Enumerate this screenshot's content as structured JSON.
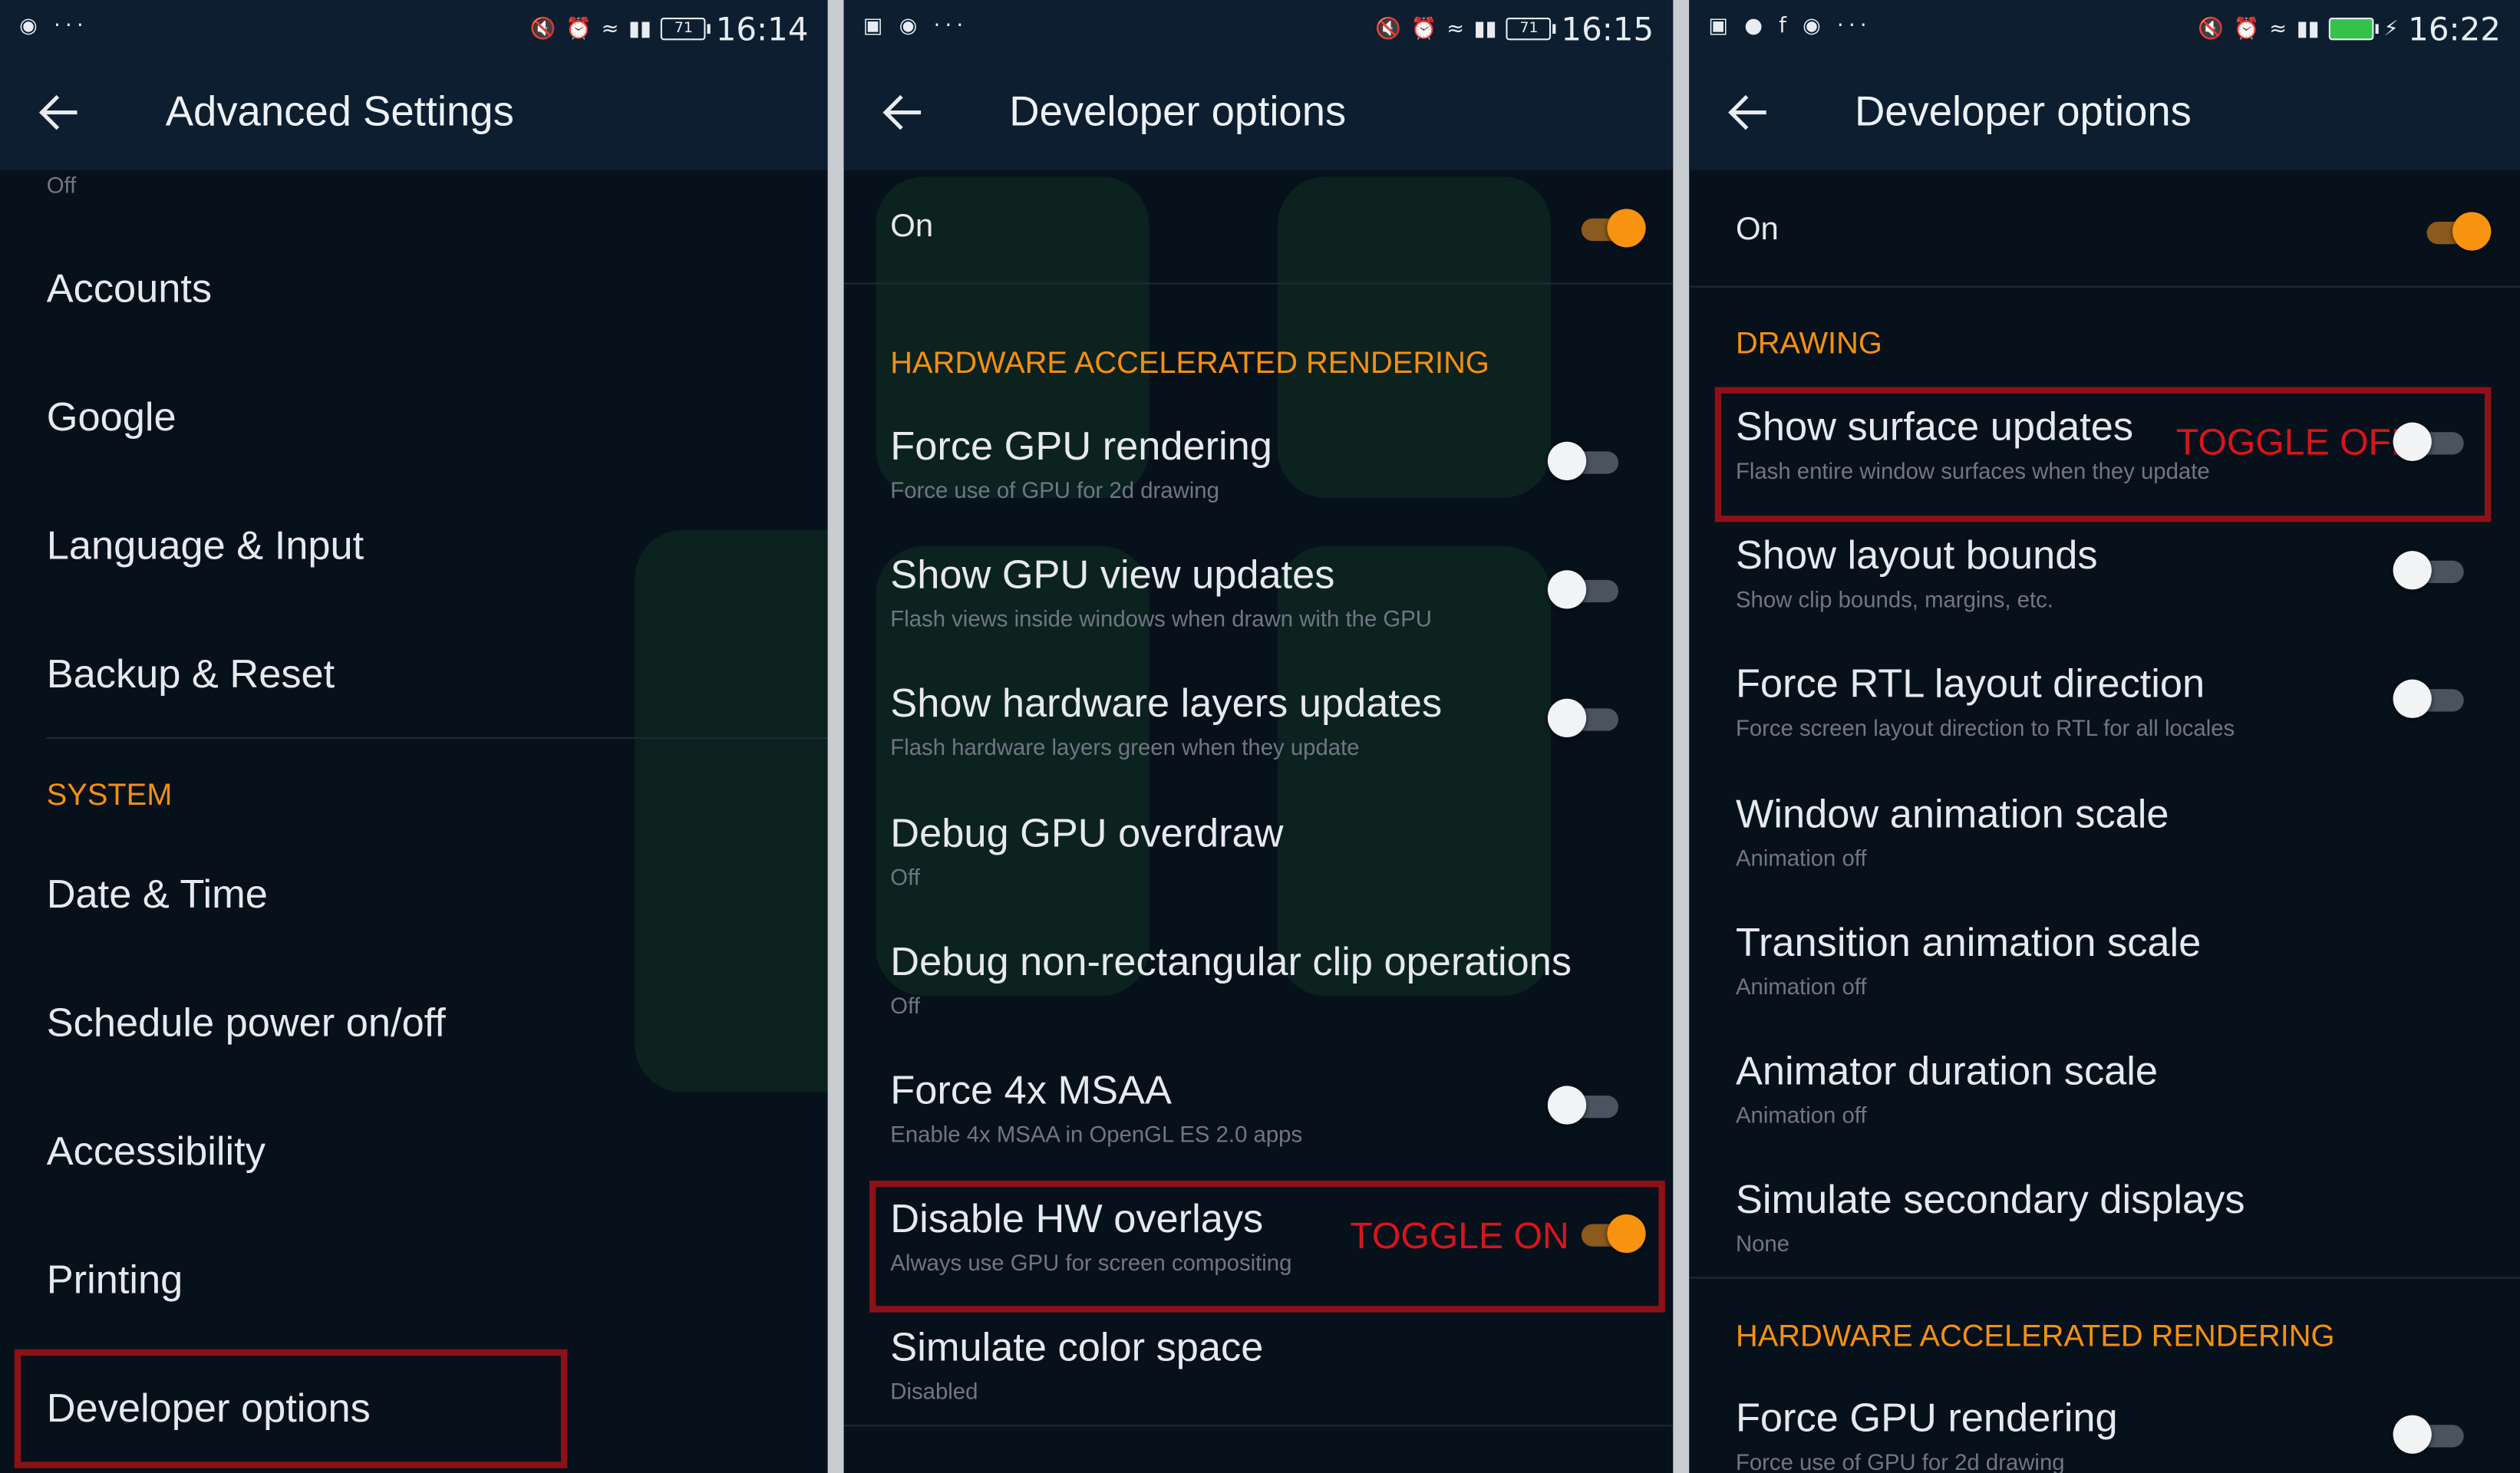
{
  "colors": {
    "accent": "#f7930f",
    "annotation": "#d8151b",
    "panel_bg": "#07111c",
    "bar_bg": "#0c1e30"
  },
  "panel1": {
    "status": {
      "left": "◉ ···",
      "battery": "71",
      "time": "16:14"
    },
    "title": "Advanced Settings",
    "partial_sub": "Off",
    "items": [
      {
        "label": "Accounts"
      },
      {
        "label": "Google"
      },
      {
        "label": "Language & Input"
      },
      {
        "label": "Backup & Reset"
      }
    ],
    "section": "SYSTEM",
    "system_items": [
      {
        "label": "Date & Time"
      },
      {
        "label": "Schedule power on/off"
      },
      {
        "label": "Accessibility"
      },
      {
        "label": "Printing"
      },
      {
        "label": "Developer options"
      }
    ]
  },
  "panel2": {
    "status": {
      "left": "▣ ◉ ···",
      "battery": "71",
      "time": "16:15"
    },
    "title": "Developer options",
    "master": {
      "label": "On",
      "on": true
    },
    "section": "HARDWARE ACCELERATED RENDERING",
    "items": [
      {
        "title": "Force GPU rendering",
        "sub": "Force use of GPU for 2d drawing",
        "toggle": false
      },
      {
        "title": "Show GPU view updates",
        "sub": "Flash views inside windows when drawn with the GPU",
        "toggle": false
      },
      {
        "title": "Show hardware layers updates",
        "sub": "Flash hardware layers green when they update",
        "toggle": false
      },
      {
        "title": "Debug GPU overdraw",
        "sub": "Off"
      },
      {
        "title": "Debug non-rectangular clip operations",
        "sub": "Off"
      },
      {
        "title": "Force 4x MSAA",
        "sub": "Enable 4x MSAA in OpenGL ES 2.0 apps",
        "toggle": false
      },
      {
        "title": "Disable HW overlays",
        "sub": "Always use GPU for screen compositing",
        "toggle": true
      },
      {
        "title": "Simulate color space",
        "sub": "Disabled"
      }
    ],
    "annotation": "TOGGLE ON"
  },
  "panel3": {
    "status": {
      "left": "▣ ● f ◉ ···",
      "battery": "",
      "time": "16:22"
    },
    "title": "Developer options",
    "master": {
      "label": "On",
      "on": true
    },
    "section": "DRAWING",
    "items": [
      {
        "title": "Show surface updates",
        "sub": "Flash entire window surfaces when they update",
        "toggle": false
      },
      {
        "title": "Show layout bounds",
        "sub": "Show clip bounds, margins, etc.",
        "toggle": false
      },
      {
        "title": "Force RTL layout direction",
        "sub": "Force screen layout direction to RTL for all locales",
        "toggle": false
      },
      {
        "title": "Window animation scale",
        "sub": "Animation off"
      },
      {
        "title": "Transition animation scale",
        "sub": "Animation off"
      },
      {
        "title": "Animator duration scale",
        "sub": "Animation off"
      },
      {
        "title": "Simulate secondary displays",
        "sub": "None"
      }
    ],
    "section2": "HARDWARE ACCELERATED RENDERING",
    "items2": [
      {
        "title": "Force GPU rendering",
        "sub": "Force use of GPU for 2d drawing",
        "toggle": false
      }
    ],
    "annotation": "TOGGLE OFF"
  }
}
